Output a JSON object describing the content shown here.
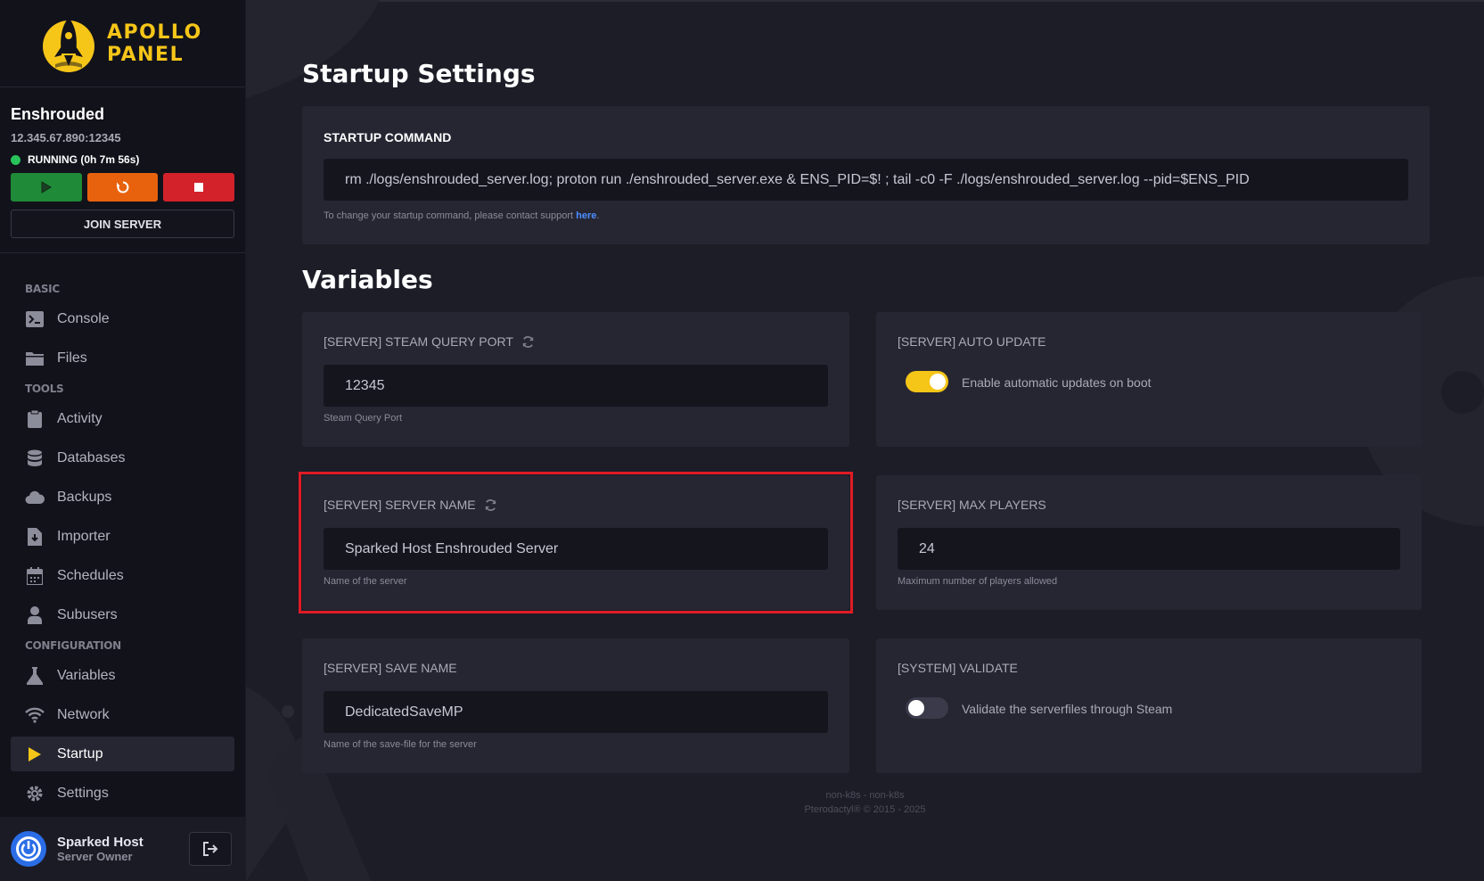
{
  "brand": {
    "line1": "APOLLO",
    "line2": "PANEL"
  },
  "server": {
    "name": "Enshrouded",
    "address": "12.345.67.890:12345",
    "status": "RUNNING (0h 7m 56s)",
    "join_label": "JOIN SERVER"
  },
  "nav": {
    "basic_label": "BASIC",
    "tools_label": "TOOLS",
    "config_label": "CONFIGURATION",
    "items": [
      {
        "label": "Console",
        "icon": "terminal-icon"
      },
      {
        "label": "Files",
        "icon": "folder-icon"
      },
      {
        "label": "Activity",
        "icon": "clipboard-icon"
      },
      {
        "label": "Databases",
        "icon": "database-icon"
      },
      {
        "label": "Backups",
        "icon": "cloud-icon"
      },
      {
        "label": "Importer",
        "icon": "file-import-icon"
      },
      {
        "label": "Schedules",
        "icon": "calendar-icon"
      },
      {
        "label": "Subusers",
        "icon": "user-icon"
      },
      {
        "label": "Variables",
        "icon": "flask-icon"
      },
      {
        "label": "Network",
        "icon": "wifi-icon"
      },
      {
        "label": "Startup",
        "icon": "play-icon"
      },
      {
        "label": "Settings",
        "icon": "gear-icon"
      }
    ]
  },
  "user": {
    "name": "Sparked Host",
    "role": "Server Owner"
  },
  "startup": {
    "title": "Startup Settings",
    "command_label": "STARTUP COMMAND",
    "command": "rm ./logs/enshrouded_server.log; proton run ./enshrouded_server.exe & ENS_PID=$! ; tail -c0 -F ./logs/enshrouded_server.log --pid=$ENS_PID",
    "hint_prefix": "To change your startup command, please contact support ",
    "hint_link": "here",
    "hint_suffix": "."
  },
  "variables": {
    "title": "Variables",
    "steam_port": {
      "label": "[SERVER] STEAM QUERY PORT",
      "value": "12345",
      "hint": "Steam Query Port"
    },
    "auto_update": {
      "label": "[SERVER] AUTO UPDATE",
      "toggle_text": "Enable automatic updates on boot",
      "enabled": true
    },
    "server_name": {
      "label": "[SERVER] SERVER NAME",
      "value": "Sparked Host Enshrouded Server",
      "hint": "Name of the server"
    },
    "max_players": {
      "label": "[SERVER] MAX PLAYERS",
      "value": "24",
      "hint": "Maximum number of players allowed"
    },
    "save_name": {
      "label": "[SERVER] SAVE NAME",
      "value": "DedicatedSaveMP",
      "hint": "Name of the save-file for the server"
    },
    "validate": {
      "label": "[SYSTEM] VALIDATE",
      "toggle_text": "Validate the serverfiles through Steam",
      "enabled": false
    }
  },
  "footer": {
    "line1": "non-k8s - non-k8s",
    "line2": "Pterodactyl® © 2015 - 2025"
  },
  "colors": {
    "accent": "#f5c518",
    "highlight": "#e01b24",
    "running": "#28c35a"
  }
}
